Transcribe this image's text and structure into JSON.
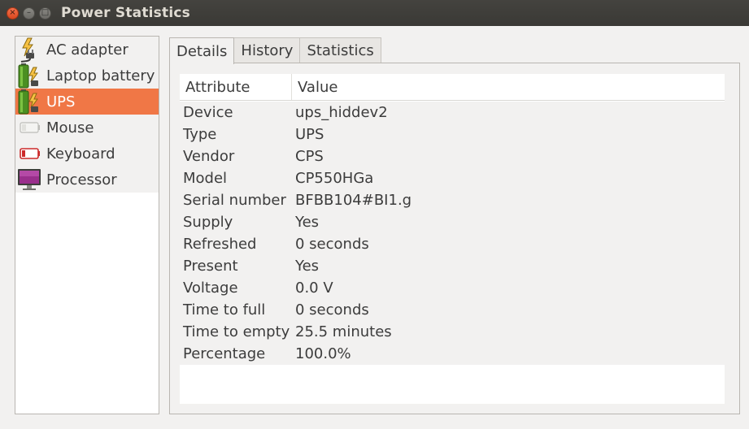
{
  "window": {
    "title": "Power Statistics",
    "buttons": {
      "close": "×",
      "minimize": "–",
      "maximize": "□"
    }
  },
  "sidebar": {
    "items": [
      {
        "label": "AC adapter",
        "icon": "ac-adapter-icon",
        "selected": false
      },
      {
        "label": "Laptop battery",
        "icon": "laptop-battery-icon",
        "selected": false
      },
      {
        "label": "UPS",
        "icon": "ups-icon",
        "selected": true
      },
      {
        "label": "Mouse",
        "icon": "mouse-battery-icon",
        "selected": false
      },
      {
        "label": "Keyboard",
        "icon": "keyboard-battery-icon",
        "selected": false
      },
      {
        "label": "Processor",
        "icon": "processor-icon",
        "selected": false
      }
    ]
  },
  "tabs": [
    {
      "label": "Details",
      "active": true
    },
    {
      "label": "History",
      "active": false
    },
    {
      "label": "Statistics",
      "active": false
    }
  ],
  "details": {
    "columns": {
      "attribute": "Attribute",
      "value": "Value"
    },
    "rows": [
      {
        "attribute": "Device",
        "value": "ups_hiddev2"
      },
      {
        "attribute": "Type",
        "value": "UPS"
      },
      {
        "attribute": "Vendor",
        "value": "CPS"
      },
      {
        "attribute": "Model",
        "value": "CP550HGa"
      },
      {
        "attribute": "Serial number",
        "value": "BFBB104#BI1.g"
      },
      {
        "attribute": "Supply",
        "value": "Yes"
      },
      {
        "attribute": "Refreshed",
        "value": "0 seconds"
      },
      {
        "attribute": "Present",
        "value": "Yes"
      },
      {
        "attribute": "Voltage",
        "value": "0.0 V"
      },
      {
        "attribute": "Time to full",
        "value": "0 seconds"
      },
      {
        "attribute": "Time to empty",
        "value": "25.5 minutes"
      },
      {
        "attribute": "Percentage",
        "value": "100.0%"
      }
    ]
  },
  "colors": {
    "selection": "#f07746",
    "titlebar": "#3c3b37",
    "close_button": "#e9582f"
  }
}
